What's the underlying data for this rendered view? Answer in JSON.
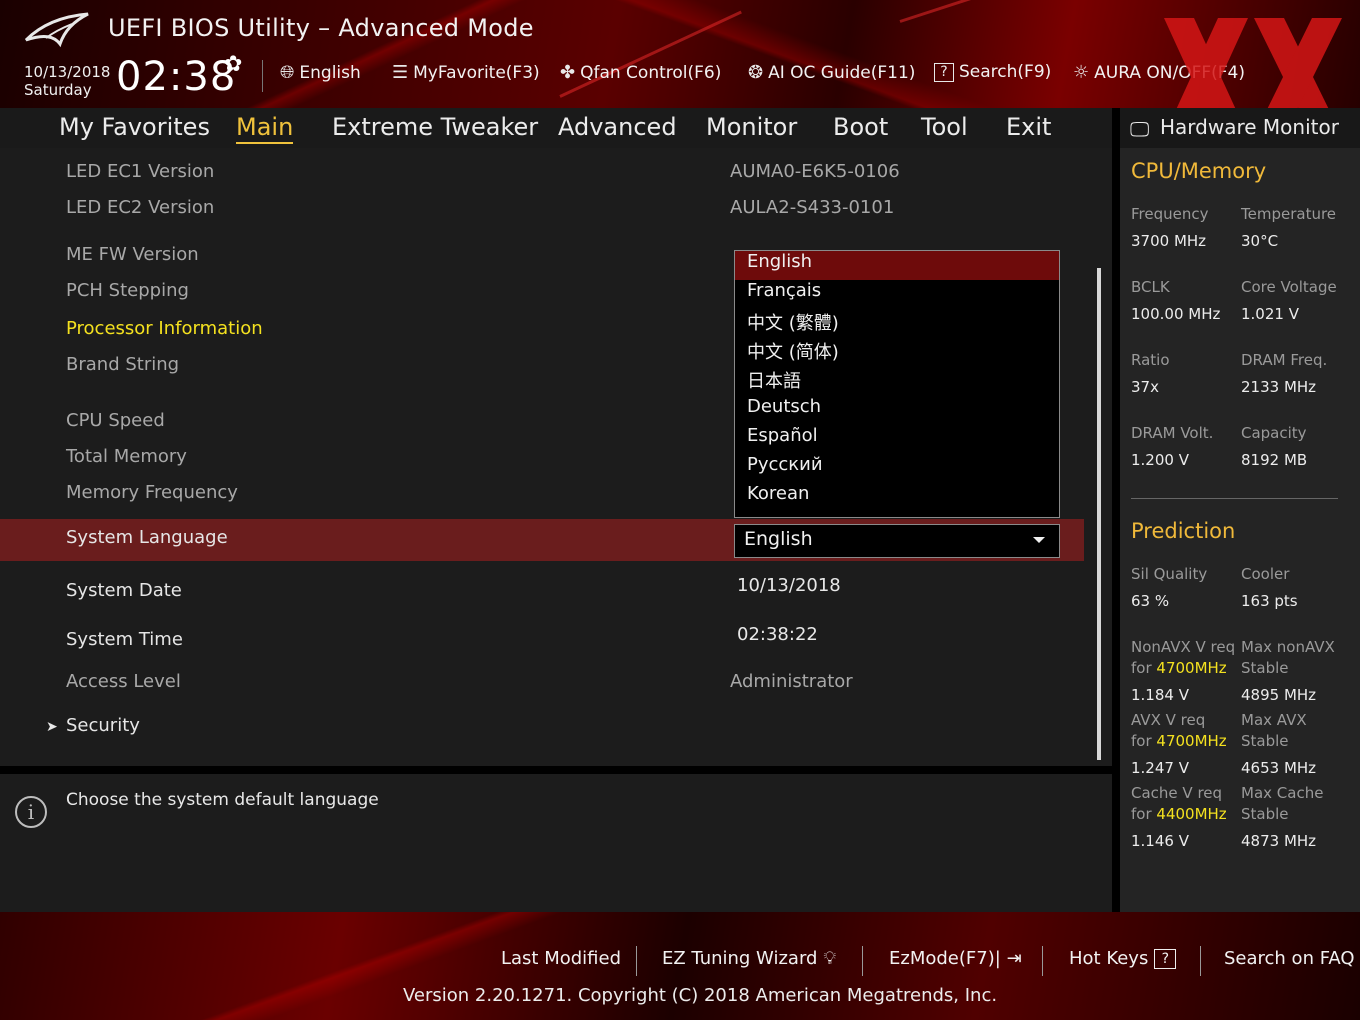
{
  "header": {
    "title": "UEFI BIOS Utility – Advanced Mode",
    "date": "10/13/2018",
    "day": "Saturday",
    "time": "02:38",
    "toolbar": {
      "language": "English",
      "favorite": "MyFavorite(F3)",
      "qfan": "Qfan Control(F6)",
      "aioc": "AI OC Guide(F11)",
      "search": "Search(F9)",
      "aura": "AURA ON/OFF(F4)"
    }
  },
  "menu": [
    "My Favorites",
    "Main",
    "Extreme Tweaker",
    "Advanced",
    "Monitor",
    "Boot",
    "Tool",
    "Exit"
  ],
  "main": {
    "rows": {
      "led_ec1": {
        "label": "LED EC1 Version",
        "value": "AUMA0-E6K5-0106"
      },
      "led_ec2": {
        "label": "LED EC2 Version",
        "value": "AULA2-S433-0101"
      },
      "me_fw": {
        "label": "ME FW Version"
      },
      "pch": {
        "label": "PCH Stepping"
      },
      "proc_info": {
        "label": "Processor Information"
      },
      "brand": {
        "label": "Brand String"
      },
      "cpu_speed": {
        "label": "CPU Speed"
      },
      "total_mem": {
        "label": "Total Memory"
      },
      "mem_freq": {
        "label": "Memory Frequency"
      },
      "sys_lang": {
        "label": "System Language",
        "value": "English"
      },
      "sys_date": {
        "label": "System Date",
        "value": "10/13/2018"
      },
      "sys_time": {
        "label": "System Time",
        "value": "02:38:22"
      },
      "access": {
        "label": "Access Level",
        "value": "Administrator"
      },
      "security": {
        "label": "Security"
      }
    },
    "language_options": [
      "English",
      "Français",
      "中文 (繁體)",
      "中文 (简体)",
      "日本語",
      "Deutsch",
      "Español",
      "Русский",
      "Korean"
    ]
  },
  "help": {
    "text": "Choose the system default language"
  },
  "hw_monitor": {
    "title": "Hardware Monitor",
    "cpu_section": "CPU/Memory",
    "cpu": {
      "frequency_label": "Frequency",
      "frequency": "3700 MHz",
      "temperature_label": "Temperature",
      "temperature": "30°C",
      "bclk_label": "BCLK",
      "bclk": "100.00 MHz",
      "core_voltage_label": "Core Voltage",
      "core_voltage": "1.021 V",
      "ratio_label": "Ratio",
      "ratio": "37x",
      "dram_freq_label": "DRAM Freq.",
      "dram_freq": "2133 MHz",
      "dram_volt_label": "DRAM Volt.",
      "dram_volt": "1.200 V",
      "capacity_label": "Capacity",
      "capacity": "8192 MB"
    },
    "prediction_section": "Prediction",
    "prediction": {
      "sil_quality_label": "Sil Quality",
      "sil_quality": "63 %",
      "cooler_label": "Cooler",
      "cooler": "163 pts",
      "nonavx_req_label": "NonAVX V req",
      "for_label": "for",
      "freq_4700": "4700MHz",
      "freq_4400": "4400MHz",
      "nonavx_req": "1.184 V",
      "max_nonavx_label": "Max nonAVX",
      "stable_label": "Stable",
      "max_nonavx": "4895 MHz",
      "avx_req_label": "AVX V req",
      "avx_req": "1.247 V",
      "max_avx_label": "Max AVX",
      "max_avx": "4653 MHz",
      "cache_req_label": "Cache V req",
      "cache_req": "1.146 V",
      "max_cache_label": "Max Cache",
      "max_cache": "4873 MHz"
    }
  },
  "footer": {
    "last_modified": "Last Modified",
    "ez_tuning": "EZ Tuning Wizard",
    "ezmode": "EzMode(F7)|",
    "hotkeys": "Hot Keys",
    "hotkeys_key": "?",
    "faq": "Search on FAQ",
    "version": "Version 2.20.1271. Copyright (C) 2018 American Megatrends, Inc."
  },
  "colors": {
    "accent": "#f0c23c",
    "highlight": "#f4e11f",
    "selected_row": "#6a1d1d",
    "brand_red": "#c01818"
  }
}
